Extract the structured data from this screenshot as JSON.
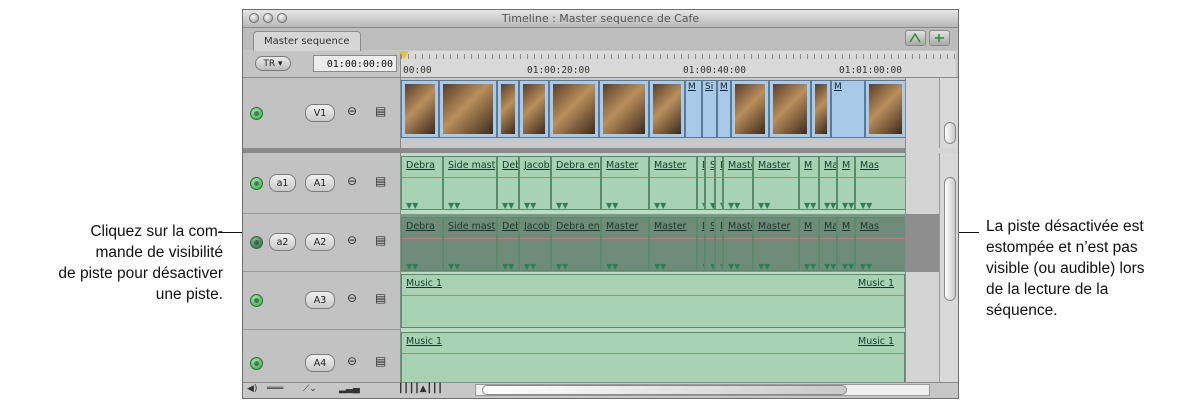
{
  "window": {
    "title": "Timeline : Master sequence de Cafe",
    "tab": "Master sequence",
    "tc_menu": "TR ▾",
    "timecode": "01:00:00:00"
  },
  "ruler": {
    "labels": [
      "00:00",
      "01:00:20:00",
      "01:00:40:00",
      "01:01:00:00"
    ]
  },
  "tracks": {
    "v1": {
      "label": "V1"
    },
    "a1": {
      "source": "a1",
      "label": "A1"
    },
    "a2": {
      "source": "a2",
      "label": "A2"
    },
    "a3": {
      "label": "A3"
    },
    "a4": {
      "label": "A4"
    }
  },
  "video_clips": [
    "",
    "",
    "",
    "",
    "",
    "",
    "",
    "M",
    "Si",
    "M",
    "",
    "",
    "",
    "M",
    ""
  ],
  "audio_clips": [
    "Debra",
    "Side mast",
    "Debr",
    "Jacob",
    "Debra en",
    "Master",
    "Master",
    "M",
    "Si",
    "M",
    "Maste",
    "Master",
    "M",
    "Mas",
    "M",
    "Mas"
  ],
  "music_clips": [
    "Music 1",
    "Music 1"
  ],
  "callouts": {
    "left": [
      "Cliquez sur la com-",
      "mande de visibilité",
      "de piste pour désactiver",
      "une piste."
    ],
    "right": [
      "La piste désactivée est",
      "estompée et n’est pas",
      "visible (ou audible) lors",
      "de la lecture de la",
      "séquence."
    ]
  }
}
